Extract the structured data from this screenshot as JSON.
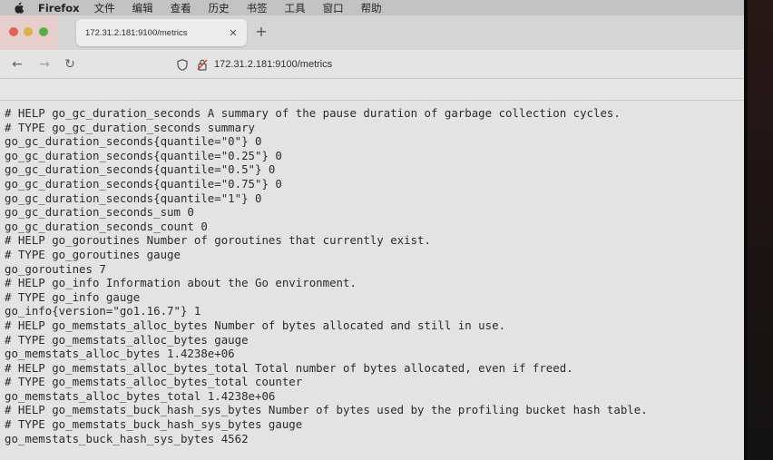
{
  "menubar": {
    "app_name": "Firefox",
    "items": [
      "文件",
      "编辑",
      "查看",
      "历史",
      "书签",
      "工具",
      "窗口",
      "帮助"
    ]
  },
  "tab": {
    "title": "172.31.2.181:9100/metrics",
    "close_glyph": "✕",
    "new_tab_glyph": "+"
  },
  "navbar": {
    "back_glyph": "←",
    "forward_glyph": "→",
    "reload_glyph": "↻",
    "url": "172.31.2.181:9100/metrics"
  },
  "metrics_lines": [
    "# HELP go_gc_duration_seconds A summary of the pause duration of garbage collection cycles.",
    "# TYPE go_gc_duration_seconds summary",
    "go_gc_duration_seconds{quantile=\"0\"} 0",
    "go_gc_duration_seconds{quantile=\"0.25\"} 0",
    "go_gc_duration_seconds{quantile=\"0.5\"} 0",
    "go_gc_duration_seconds{quantile=\"0.75\"} 0",
    "go_gc_duration_seconds{quantile=\"1\"} 0",
    "go_gc_duration_seconds_sum 0",
    "go_gc_duration_seconds_count 0",
    "# HELP go_goroutines Number of goroutines that currently exist.",
    "# TYPE go_goroutines gauge",
    "go_goroutines 7",
    "# HELP go_info Information about the Go environment.",
    "# TYPE go_info gauge",
    "go_info{version=\"go1.16.7\"} 1",
    "# HELP go_memstats_alloc_bytes Number of bytes allocated and still in use.",
    "# TYPE go_memstats_alloc_bytes gauge",
    "go_memstats_alloc_bytes 1.4238e+06",
    "# HELP go_memstats_alloc_bytes_total Total number of bytes allocated, even if freed.",
    "# TYPE go_memstats_alloc_bytes_total counter",
    "go_memstats_alloc_bytes_total 1.4238e+06",
    "# HELP go_memstats_buck_hash_sys_bytes Number of bytes used by the profiling bucket hash table.",
    "# TYPE go_memstats_buck_hash_sys_bytes gauge",
    "go_memstats_buck_hash_sys_bytes 4562"
  ],
  "colors": {
    "traffic_red": "#e8665a",
    "traffic_yellow": "#e0b84a",
    "traffic_green": "#5cb546",
    "lock_warning": "#d9463a"
  },
  "icons": [
    "apple-icon",
    "shield-icon",
    "insecure-lock-icon",
    "back-arrow-icon",
    "forward-arrow-icon",
    "reload-icon",
    "close-icon",
    "plus-icon"
  ]
}
